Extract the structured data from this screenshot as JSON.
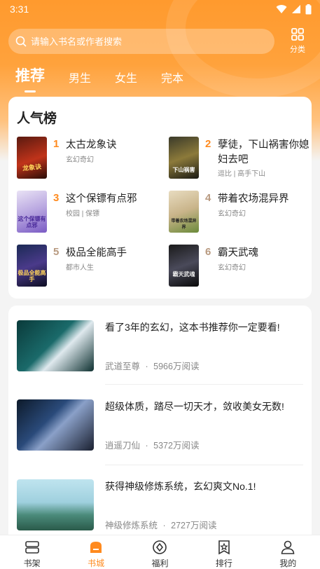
{
  "status": {
    "time": "3:31"
  },
  "search": {
    "placeholder": "请输入书名或作者搜索"
  },
  "category": {
    "label": "分类"
  },
  "tabs": [
    {
      "label": "推荐",
      "active": true
    },
    {
      "label": "男生"
    },
    {
      "label": "女生"
    },
    {
      "label": "完本"
    }
  ],
  "ranking": {
    "title": "人气榜",
    "items": [
      {
        "num": "1",
        "name": "太古龙象诀",
        "tag": "玄幻奇幻",
        "cover_text": "龙象诀"
      },
      {
        "num": "2",
        "name": "孽徒，下山祸害你媳妇去吧",
        "tag": "逗比 | 高手下山",
        "cover_text": "下山祸害"
      },
      {
        "num": "3",
        "name": "这个保镖有点邪",
        "tag": "校园 | 保镖",
        "cover_text": "这个保镖有点邪"
      },
      {
        "num": "4",
        "name": "带着农场混异界",
        "tag": "玄幻奇幻",
        "cover_text": "带着农场混异界"
      },
      {
        "num": "5",
        "name": "极品全能高手",
        "tag": "都市人生",
        "cover_text": "极品全能高手"
      },
      {
        "num": "6",
        "name": "霸天武魂",
        "tag": "玄幻奇幻",
        "cover_text": "霸天武魂"
      }
    ]
  },
  "feed": [
    {
      "title": "看了3年的玄幻，这本书推荐你一定要看!",
      "book": "武道至尊",
      "reads": "5966万阅读"
    },
    {
      "title": "超级体质，踏尽一切天才，敛收美女无数!",
      "book": "逍遥刀仙",
      "reads": "5372万阅读"
    },
    {
      "title": "获得神级修炼系统，玄幻爽文No.1!",
      "book": "神级修炼系统",
      "reads": "2727万阅读"
    }
  ],
  "feed_separator": "·",
  "nav": [
    {
      "label": "书架",
      "icon": "bookshelf-icon"
    },
    {
      "label": "书城",
      "icon": "bookstore-icon",
      "active": true
    },
    {
      "label": "福利",
      "icon": "welfare-icon"
    },
    {
      "label": "排行",
      "icon": "ranking-icon"
    },
    {
      "label": "我的",
      "icon": "profile-icon"
    }
  ],
  "colors": {
    "accent": "#ff8a1e",
    "rank_top": "#ff8a1e",
    "rank_other": "#b89a80"
  }
}
